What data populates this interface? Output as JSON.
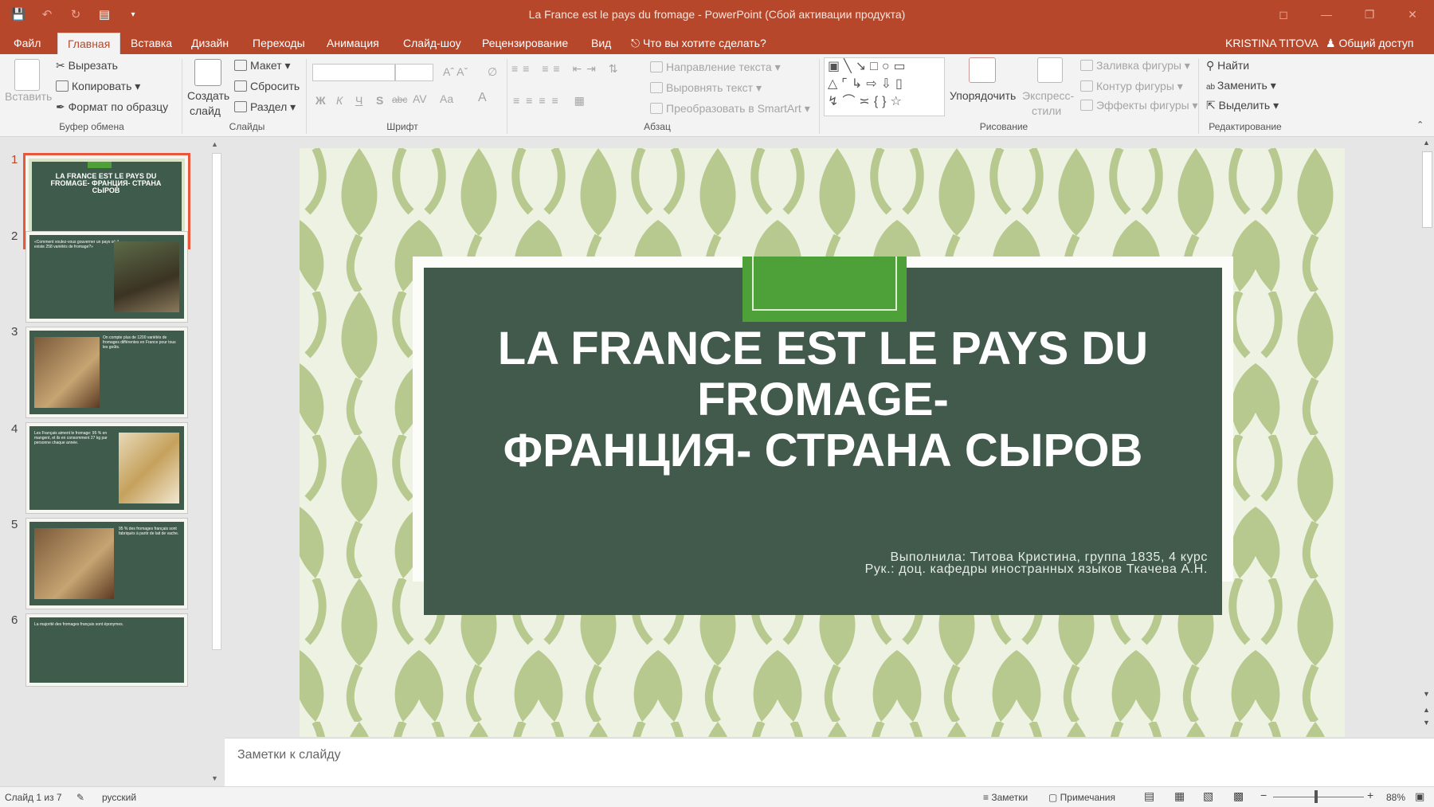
{
  "app": {
    "title": "La France est le pays du fromage - PowerPoint (Сбой активации продукта)"
  },
  "tabs": [
    {
      "label": "Файл",
      "active": false
    },
    {
      "label": "Главная",
      "active": true
    },
    {
      "label": "Вставка",
      "active": false
    },
    {
      "label": "Дизайн",
      "active": false
    },
    {
      "label": "Переходы",
      "active": false
    },
    {
      "label": "Анимация",
      "active": false
    },
    {
      "label": "Слайд-шоу",
      "active": false
    },
    {
      "label": "Рецензирование",
      "active": false
    },
    {
      "label": "Вид",
      "active": false
    }
  ],
  "tell_me": "Что вы хотите сделать?",
  "user": "KRISTINA TITOVA",
  "share": "Общий доступ",
  "ribbon": {
    "clipboard": {
      "paste": "Вставить",
      "cut": "Вырезать",
      "copy": "Копировать",
      "format": "Формат по образцу",
      "group": "Буфер обмена"
    },
    "slides": {
      "new_slide": "Создать",
      "new_slide2": "слайд",
      "layout": "Макет",
      "reset": "Сбросить",
      "section": "Раздел",
      "group": "Слайды"
    },
    "font": {
      "bold": "Ж",
      "italic": "К",
      "underline": "Ч",
      "shadow": "S",
      "strike": "abc",
      "spacing": "AV",
      "case": "Aa",
      "color": "A",
      "group": "Шрифт"
    },
    "paragraph": {
      "direction": "Направление текста",
      "align": "Выровнять текст",
      "smartart": "Преобразовать в SmartArt",
      "group": "Абзац"
    },
    "drawing": {
      "arrange": "Упорядочить",
      "quick1": "Экспресс-",
      "quick2": "стили",
      "fill": "Заливка фигуры",
      "outline": "Контур фигуры",
      "effects": "Эффекты фигуры",
      "group": "Рисование"
    },
    "editing": {
      "find": "Найти",
      "replace": "Заменить",
      "select": "Выделить",
      "group": "Редактирование"
    }
  },
  "thumbnails": [
    {
      "num": "1",
      "text": "LA FRANCE EST LE PAYS DU FROMAGE- ФРАНЦИЯ- СТРАНА СЫРОВ",
      "selected": true
    },
    {
      "num": "2",
      "text": "«Comment voulez-vous gouverner un pays où il existe 258 variétés de fromage?»",
      "selected": false
    },
    {
      "num": "3",
      "text": "On compte plus de 1200 variétés de fromages différentes en France pour tous les goûts.",
      "selected": false
    },
    {
      "num": "4",
      "text": "Les Français aiment le fromage: 95 % en mangent, et ils en consomment 27 kg par personne chaque année.",
      "selected": false
    },
    {
      "num": "5",
      "text": "95 % des fromages français sont fabriqués à partir de lait de vache.",
      "selected": false
    },
    {
      "num": "6",
      "text": "La majorité des fromages français sont éponymes.",
      "selected": false
    }
  ],
  "slide": {
    "title_line1": "LA FRANCE EST LE PAYS DU FROMAGE-",
    "title_line2": "ФРАНЦИЯ- СТРАНА СЫРОВ",
    "sub_line1": "Выполнила: Титова Кристина, группа 1835, 4 курс",
    "sub_line2": "Рук.: доц. кафедры иностранных языков Ткачева А.Н."
  },
  "notes_placeholder": "Заметки к слайду",
  "status": {
    "slide": "Слайд 1 из 7",
    "lang": "русский",
    "notes": "Заметки",
    "comments": "Примечания",
    "zoom": "88%"
  },
  "colors": {
    "accent": "#b7472a",
    "slide_panel": "#415a4b",
    "slide_tab": "#4ea039",
    "pattern": "#b7c98f"
  },
  "icons": [
    "save-icon",
    "undo-icon",
    "redo-icon",
    "present-icon",
    "lightbulb-icon",
    "person-icon",
    "scissors-icon",
    "copy-icon",
    "brush-icon",
    "search-icon",
    "cursor-icon"
  ]
}
